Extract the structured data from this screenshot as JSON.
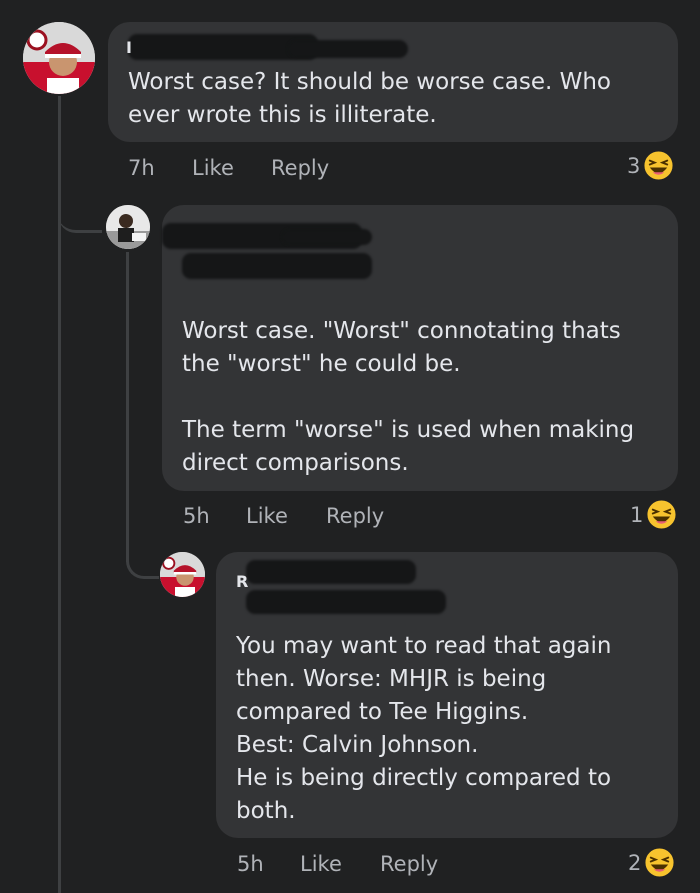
{
  "comments": [
    {
      "author_initial": "I",
      "text": "Worst case? It should be worse case. Who\never wrote this is illiterate.",
      "time": "7h",
      "like_label": "Like",
      "reply_label": "Reply",
      "reaction_count": "3",
      "reaction_icon": "laughing-emoji"
    },
    {
      "author_initial": "",
      "text": "Worst case. \"Worst\" connotating thats\nthe \"worst\" he could be.\n\nThe term \"worse\" is used when making\ndirect comparisons.",
      "time": "5h",
      "like_label": "Like",
      "reply_label": "Reply",
      "reaction_count": "1",
      "reaction_icon": "laughing-emoji"
    },
    {
      "author_initial": "R",
      "text": "You may want to read that again\nthen. Worse: MHJR is being\ncompared to Tee Higgins.\nBest: Calvin Johnson.\nHe is being directly compared to\nboth.",
      "time": "5h",
      "like_label": "Like",
      "reply_label": "Reply",
      "reaction_count": "2",
      "reaction_icon": "laughing-emoji"
    }
  ],
  "colors": {
    "background": "#202122",
    "bubble": "#333436",
    "text": "#e4e6eb",
    "secondary_text": "#b0b3b8",
    "emoji": "#f7c32e"
  }
}
